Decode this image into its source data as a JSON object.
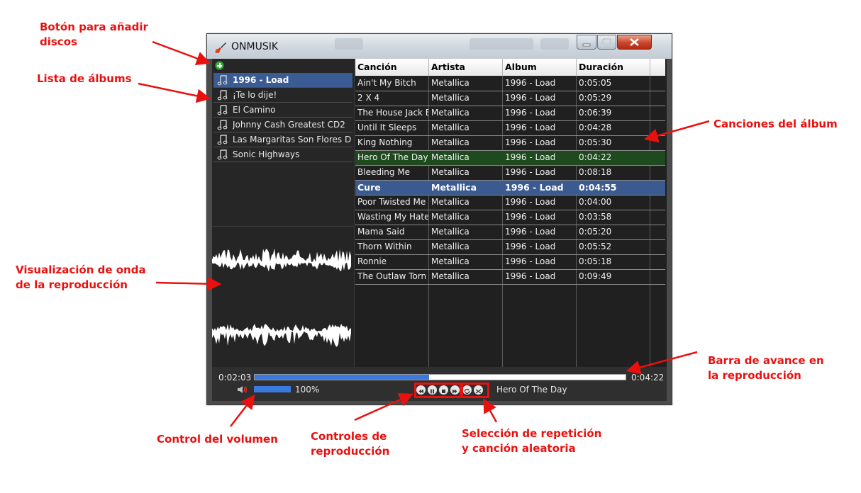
{
  "annotations": {
    "add_discs": [
      "Botón para añadir",
      "discos"
    ],
    "album_list": [
      "Lista de álbums"
    ],
    "waveform": [
      "Visualización de onda",
      "de la reproducción"
    ],
    "songs": [
      "Canciones del álbum"
    ],
    "progress": [
      "Barra de avance en",
      "la reproducción"
    ],
    "volume": [
      "Control del volumen"
    ],
    "playback": [
      "Controles de",
      "reproducción"
    ],
    "repeat": [
      "Selección de repetición",
      "y canción aleatoria"
    ]
  },
  "window": {
    "title": "ONMUSIK"
  },
  "albums": [
    {
      "label": "1996 - Load",
      "selected": true
    },
    {
      "label": "¡Te lo dije!"
    },
    {
      "label": "El Camino"
    },
    {
      "label": "Johnny Cash Greatest CD2"
    },
    {
      "label": "Las Margaritas Son Flores Del"
    },
    {
      "label": "Sonic Highways"
    }
  ],
  "table": {
    "columns": [
      "Canción",
      "Artista",
      "Album",
      "Duración"
    ],
    "rows": [
      {
        "song": "Ain't My Bitch",
        "artist": "Metallica",
        "album": "1996 - Load",
        "duration": "0:05:05"
      },
      {
        "song": "2 X 4",
        "artist": "Metallica",
        "album": "1996 - Load",
        "duration": "0:05:29"
      },
      {
        "song": "The House Jack B",
        "artist": "Metallica",
        "album": "1996 - Load",
        "duration": "0:06:39"
      },
      {
        "song": "Until It Sleeps",
        "artist": "Metallica",
        "album": "1996 - Load",
        "duration": "0:04:28"
      },
      {
        "song": "King Nothing",
        "artist": "Metallica",
        "album": "1996 - Load",
        "duration": "0:05:30"
      },
      {
        "song": "Hero Of The Day",
        "artist": "Metallica",
        "album": "1996 - Load",
        "duration": "0:04:22",
        "state": "green"
      },
      {
        "song": "Bleeding Me",
        "artist": "Metallica",
        "album": "1996 - Load",
        "duration": "0:08:18"
      },
      {
        "song": "Cure",
        "artist": "Metallica",
        "album": "1996 - Load",
        "duration": "0:04:55",
        "state": "playing"
      },
      {
        "song": "Poor Twisted Me",
        "artist": "Metallica",
        "album": "1996 - Load",
        "duration": "0:04:00"
      },
      {
        "song": "Wasting My Hate",
        "artist": "Metallica",
        "album": "1996 - Load",
        "duration": "0:03:58"
      },
      {
        "song": "Mama Said",
        "artist": "Metallica",
        "album": "1996 - Load",
        "duration": "0:05:20"
      },
      {
        "song": "Thorn Within",
        "artist": "Metallica",
        "album": "1996 - Load",
        "duration": "0:05:52"
      },
      {
        "song": "Ronnie",
        "artist": "Metallica",
        "album": "1996 - Load",
        "duration": "0:05:18"
      },
      {
        "song": "The Outlaw Torn",
        "artist": "Metallica",
        "album": "1996 - Load",
        "duration": "0:09:49"
      }
    ]
  },
  "player": {
    "elapsed": "0:02:03",
    "total": "0:04:22",
    "progress_fraction": 0.47,
    "volume_percent": "100%",
    "volume_fraction": 1.0,
    "now_playing": "Hero Of The Day"
  },
  "colors": {
    "annotation": "#e8110f",
    "accent": "#3a7ae0",
    "selected": "#3a5b93"
  }
}
